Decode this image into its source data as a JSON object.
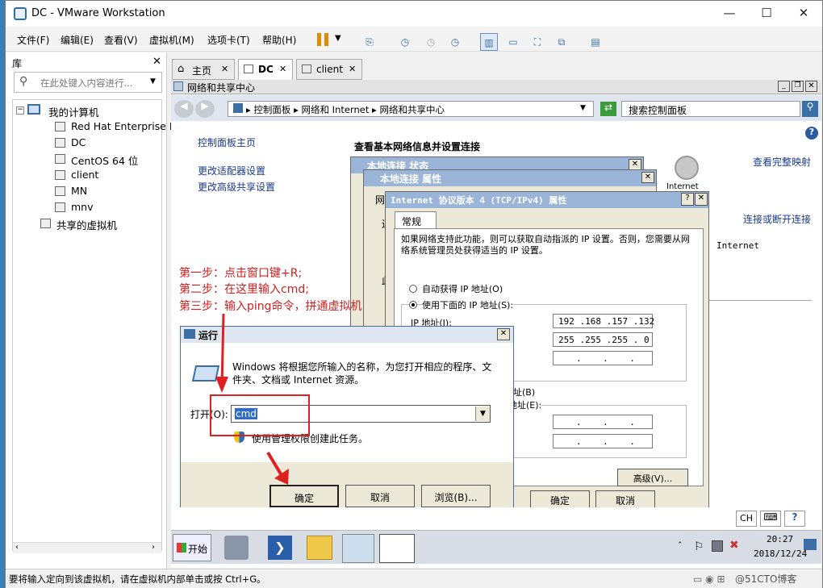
{
  "window": {
    "title": "DC - VMware Workstation"
  },
  "menu": [
    "文件(F)",
    "编辑(E)",
    "查看(V)",
    "虚拟机(M)",
    "选项卡(T)",
    "帮助(H)"
  ],
  "library": {
    "title": "库",
    "search_placeholder": "在此处键入内容进行...",
    "root": "我的计算机",
    "vms": [
      "Red Hat Enterprise L",
      "DC",
      "CentOS 64 位",
      "client",
      "MN",
      "mnv"
    ],
    "shared": "共享的虚拟机"
  },
  "tabs": [
    "主页",
    "DC",
    "client"
  ],
  "network_center": {
    "title": "网络和共享中心",
    "breadcrumb": [
      "控制面板",
      "网络和 Internet",
      "网络和共享中心"
    ],
    "search_placeholder": "搜索控制面板",
    "side_links": [
      "控制面板主页",
      "更改适配器设置",
      "更改高级共享设置"
    ],
    "heading": "查看基本网络信息并设置连接",
    "view_full_map": "查看完整映射",
    "connect_disconnect": "连接或断开连接",
    "internet_label": "Internet",
    "internet_label2": "Internet"
  },
  "status_window": {
    "title": "本地连接 状态"
  },
  "props_window": {
    "title": "本地连接 属性",
    "fragments": [
      "网",
      "连",
      "此"
    ]
  },
  "ipv4": {
    "title": "Internet 协议版本 4 (TCP/IPv4) 属性",
    "tab": "常规",
    "desc": "如果网络支持此功能，则可以获取自动指派的 IP 设置。否则，您需要从网络系统管理员处获得适当的 IP 设置。",
    "auto_ip": "自动获得 IP 地址(O)",
    "manual_ip": "使用下面的 IP 地址(S):",
    "ip_label": "IP 地址(I):",
    "ip_value": "192 .168 .157 .132",
    "mask_value": "255 .255 .255 . 0",
    "gateway_value": ".    .    .",
    "dns_frag1": "地址(B)",
    "dns_frag2": "器地址(E):",
    "dns1_value": ".    .    .",
    "dns2_value": ".    .    .",
    "advanced": "高级(V)...",
    "ok": "确定",
    "cancel": "取消"
  },
  "annotation": {
    "step1": "第一步：点击窗口键+R;",
    "step2": "第二步：在这里输入cmd;",
    "step3": "第三步：输入ping命令，拼通虚拟机"
  },
  "run": {
    "title": "运行",
    "desc": "Windows 将根据您所输入的名称，为您打开相应的程序、文件夹、文档或 Internet 资源。",
    "open_label": "打开(O):",
    "value": "cmd",
    "admin": "使用管理权限创建此任务。",
    "ok": "确定",
    "cancel": "取消",
    "browse": "浏览(B)..."
  },
  "taskbar": {
    "start": "开始",
    "time": "20:27",
    "date": "2018/12/24",
    "lang": "CH"
  },
  "status": {
    "text": "要将输入定向到该虚拟机，请在虚拟机内部单击或按 Ctrl+G。",
    "watermark": "@51CTO博客"
  }
}
